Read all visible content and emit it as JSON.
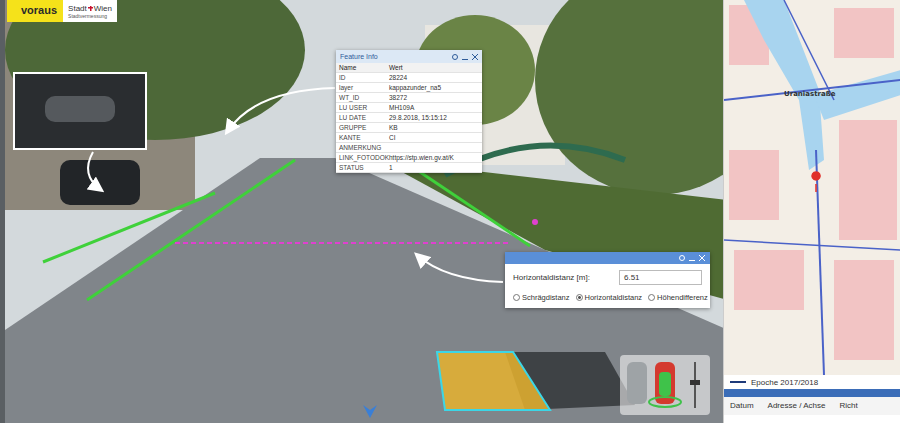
{
  "logo": {
    "brand": "voraus",
    "city_left": "Stadt",
    "city_right": "Wien",
    "department": "Stadtvermessung"
  },
  "feature_info": {
    "title": "Feature Info",
    "columns": [
      "Name",
      "Wert"
    ],
    "rows": [
      {
        "name": "ID",
        "value": "28224"
      },
      {
        "name": "layer",
        "value": "kappazunder_na5"
      },
      {
        "name": "WT_ID",
        "value": "38272"
      },
      {
        "name": "LU USER",
        "value": "MH109A"
      },
      {
        "name": "LU DATE",
        "value": "29.8.2018, 15:15:12"
      },
      {
        "name": "GRUPPE",
        "value": "KB"
      },
      {
        "name": "KANTE",
        "value": "CI"
      },
      {
        "name": "ANMERKUNG",
        "value": ""
      },
      {
        "name": "LINK_FOTODOK",
        "value": "https://stp.wien.gv.at/K"
      },
      {
        "name": "STATUS",
        "value": "1"
      }
    ]
  },
  "distance_panel": {
    "label": "Horizontaldistanz [m]:",
    "value": "6.51",
    "options": [
      {
        "label": "Schrägdistanz",
        "selected": false
      },
      {
        "label": "Horizontaldistanz",
        "selected": true
      },
      {
        "label": "Höhendifferenz",
        "selected": false
      }
    ]
  },
  "map": {
    "labels": [
      "Uraniastraße"
    ]
  },
  "legend": {
    "label": "Epoche 2017/2018"
  },
  "table": {
    "columns": [
      "Datum",
      "Adresse / Achse",
      "Richt"
    ]
  }
}
